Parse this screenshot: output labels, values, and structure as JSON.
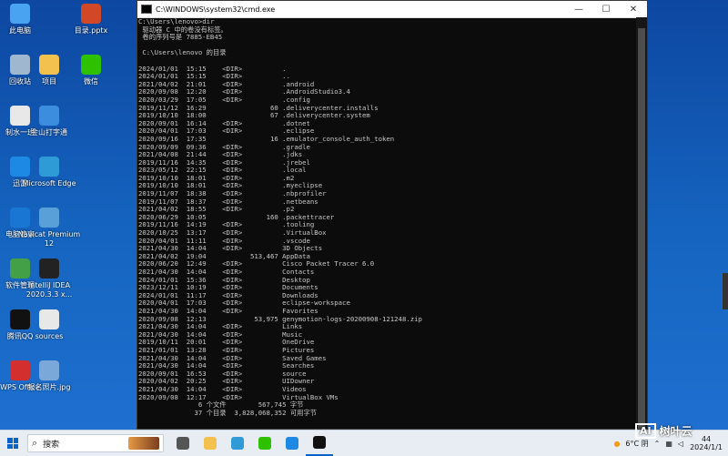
{
  "desktop_icons": [
    {
      "label": "此电脑",
      "icon": "computer-icon",
      "color": "#4aa3f0"
    },
    {
      "label": "目录.pptx",
      "icon": "pptx-icon",
      "color": "#d24726"
    },
    {
      "label": "回收站",
      "icon": "recycle-bin-icon",
      "color": "#9fb7cf"
    },
    {
      "label": "项目",
      "icon": "folder-icon",
      "color": "#f2c14e"
    },
    {
      "label": "微信",
      "icon": "wechat-icon",
      "color": "#2dc100"
    },
    {
      "label": "制水一班",
      "icon": "document-icon",
      "color": "#e8e8e8"
    },
    {
      "label": "金山打字通",
      "icon": "jinshan-icon",
      "color": "#3c8dde"
    },
    {
      "label": "迅雷",
      "icon": "xunlei-icon",
      "color": "#1e88e5"
    },
    {
      "label": "Microsoft Edge",
      "icon": "edge-icon",
      "color": "#2f9bd6"
    },
    {
      "label": "电脑管家",
      "icon": "pc-manager-icon",
      "color": "#1976d2"
    },
    {
      "label": "Navicat Premium 12",
      "icon": "navicat-icon",
      "color": "#5aa0d8"
    },
    {
      "label": "软件管理",
      "icon": "software-manager-icon",
      "color": "#43a047"
    },
    {
      "label": "IntelliJ IDEA 2020.3.3 x...",
      "icon": "intellij-icon",
      "color": "#222222"
    },
    {
      "label": "腾讯QQ",
      "icon": "qq-icon",
      "color": "#111111"
    },
    {
      "label": "sources",
      "icon": "document-icon",
      "color": "#e8e8e8"
    },
    {
      "label": "WPS Office",
      "icon": "wps-icon",
      "color": "#d32f2f"
    },
    {
      "label": "报名照片.jpg",
      "icon": "photo-icon",
      "color": "#7aa8d8"
    }
  ],
  "cmd": {
    "title": "C:\\WINDOWS\\system32\\cmd.exe",
    "lines": [
      "C:\\Users\\lenovo>dir",
      " 驱动器 C 中的卷没有标签。",
      " 卷的序列号是 7885-EB45",
      "",
      " C:\\Users\\lenovo 的目录",
      "",
      "2024/01/01  15:15    <DIR>          .",
      "2024/01/01  15:15    <DIR>          ..",
      "2021/04/02  21:01    <DIR>          .android",
      "2020/09/08  12:20    <DIR>          .AndroidStudio3.4",
      "2020/03/29  17:05    <DIR>          .config",
      "2019/11/12  16:29                60 .deliverycenter.installs",
      "2019/10/10  18:00                67 .deliverycenter.system",
      "2020/09/01  16:14    <DIR>          .dotnet",
      "2020/04/01  17:03    <DIR>          .eclipse",
      "2020/09/16  17:35                16 .emulator_console_auth_token",
      "2020/09/09  09:36    <DIR>          .gradle",
      "2021/04/08  21:44    <DIR>          .jdks",
      "2019/11/16  14:35    <DIR>          .jrebel",
      "2023/05/12  22:15    <DIR>          .local",
      "2019/10/10  18:01    <DIR>          .m2",
      "2019/10/10  18:01    <DIR>          .myeclipse",
      "2019/11/07  18:38    <DIR>          .nbprofiler",
      "2019/11/07  18:37    <DIR>          .netbeans",
      "2021/04/02  18:55    <DIR>          .p2",
      "2020/06/29  10:05               160 .packettracer",
      "2019/11/16  14:19    <DIR>          .tooling",
      "2020/10/25  13:17    <DIR>          .VirtualBox",
      "2020/04/01  11:11    <DIR>          .vscode",
      "2021/04/30  14:04    <DIR>          3D Objects",
      "2021/04/02  19:04           513,467 AppData",
      "2020/06/20  12:49    <DIR>          Cisco Packet Tracer 6.0",
      "2021/04/30  14:04    <DIR>          Contacts",
      "2024/01/01  15:36    <DIR>          Desktop",
      "2023/12/11  10:19    <DIR>          Documents",
      "2024/01/01  11:17    <DIR>          Downloads",
      "2020/04/01  17:03    <DIR>          eclipse-workspace",
      "2021/04/30  14:04    <DIR>          Favorites",
      "2020/09/08  12:13            53,975 genymotion-logs-20200908-121248.zip",
      "2021/04/30  14:04    <DIR>          Links",
      "2021/04/30  14:04    <DIR>          Music",
      "2019/10/11  20:01    <DIR>          OneDrive",
      "2021/01/01  13:28    <DIR>          Pictures",
      "2021/04/30  14:04    <DIR>          Saved Games",
      "2021/04/30  14:04    <DIR>          Searches",
      "2020/09/01  16:53    <DIR>          source",
      "2020/04/02  20:25    <DIR>          UIDowner",
      "2021/04/30  14:04    <DIR>          Videos",
      "2020/09/08  12:17    <DIR>          VirtualBox VMs",
      "               6 个文件        567,745 字节",
      "              37 个目录  3,828,068,352 可用字节"
    ]
  },
  "taskbar": {
    "search_label": "搜索",
    "apps": [
      {
        "icon": "task-view-icon",
        "color": "#555555"
      },
      {
        "icon": "file-explorer-icon",
        "color": "#f2c14e"
      },
      {
        "icon": "edge-icon",
        "color": "#2f9bd6"
      },
      {
        "icon": "wechat-icon",
        "color": "#2dc100"
      },
      {
        "icon": "qq-icon",
        "color": "#1e88e5"
      },
      {
        "icon": "cmd-icon",
        "color": "#111111"
      }
    ],
    "weather": "6°C 阴",
    "time": "44",
    "date": "2024/1/1"
  },
  "watermark": {
    "box": "AI",
    "text": "树叶云"
  }
}
